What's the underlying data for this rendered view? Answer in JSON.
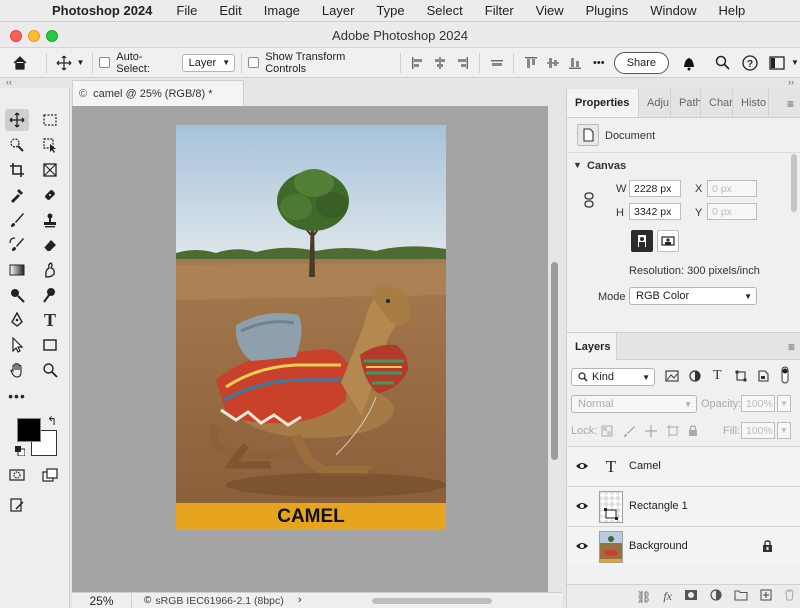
{
  "menubar": {
    "app_name": "Photoshop 2024",
    "items": [
      "File",
      "Edit",
      "Image",
      "Layer",
      "Type",
      "Select",
      "Filter",
      "View",
      "Plugins",
      "Window",
      "Help"
    ]
  },
  "window": {
    "title": "Adobe Photoshop 2024"
  },
  "options": {
    "auto_select_label": "Auto-Select:",
    "auto_select_value": "Layer",
    "show_transform_label": "Show Transform Controls",
    "share_label": "Share"
  },
  "document": {
    "tab_label": "camel @ 25% (RGB/8) *",
    "banner_text": "CAMEL",
    "banner_color": "#e6a41f"
  },
  "status": {
    "zoom": "25%",
    "profile": "sRGB IEC61966-2.1 (8bpc)"
  },
  "properties": {
    "tabs": [
      "Properties",
      "Adju",
      "Path",
      "Char",
      "Histo"
    ],
    "document_label": "Document",
    "canvas_header": "Canvas",
    "w_label": "W",
    "w_value": "2228 px",
    "h_label": "H",
    "h_value": "3342 px",
    "x_label": "X",
    "x_placeholder": "0 px",
    "y_label": "Y",
    "y_placeholder": "0 px",
    "resolution": "Resolution: 300 pixels/inch",
    "mode_label": "Mode",
    "mode_value": "RGB Color"
  },
  "layers": {
    "tab_label": "Layers",
    "kind_label": "Kind",
    "blend_mode": "Normal",
    "opacity_label": "Opacity:",
    "opacity_value": "100%",
    "lock_label": "Lock:",
    "fill_label": "Fill:",
    "fill_value": "100%",
    "items": [
      {
        "name": "Camel",
        "type": "text"
      },
      {
        "name": "Rectangle 1",
        "type": "shape"
      },
      {
        "name": "Background",
        "type": "image",
        "locked": true
      }
    ]
  },
  "colors": {
    "foreground": "#000000",
    "background": "#ffffff"
  }
}
